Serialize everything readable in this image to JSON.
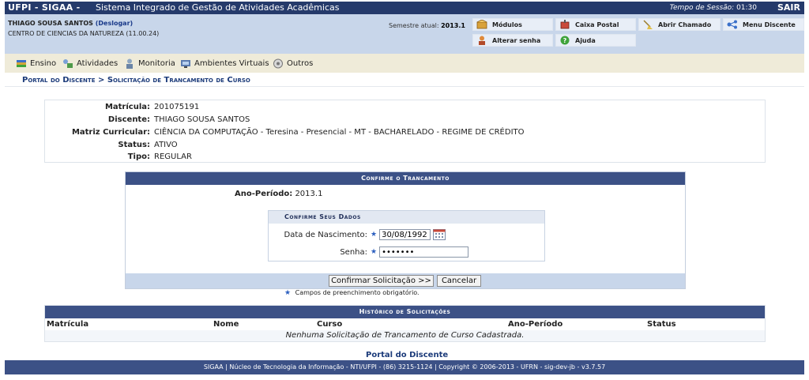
{
  "topbar": {
    "brand": "UFPI - SIGAA -",
    "system": "Sistema Integrado de Gestão de Atividades Acadêmicas",
    "session_label": "Tempo de Sessão:",
    "session_time": "01:30",
    "exit": "SAIR"
  },
  "user": {
    "name": "THIAGO SOUSA SANTOS",
    "logout": "(Deslogar)",
    "center": "CENTRO DE CIENCIAS DA NATUREZA (11.00.24)",
    "semester_label": "Semestre atual:",
    "semester_value": "2013.1"
  },
  "user_buttons": {
    "modulos": "Módulos",
    "caixa_postal": "Caixa Postal",
    "abrir_chamado": "Abrir Chamado",
    "menu_discente": "Menu Discente",
    "alterar_senha": "Alterar senha",
    "ajuda": "Ajuda"
  },
  "menu": {
    "ensino": "Ensino",
    "atividades": "Atividades",
    "monitoria": "Monitoria",
    "ambientes": "Ambientes Virtuais",
    "outros": "Outros"
  },
  "breadcrumb": {
    "root": "Portal do Discente",
    "separator": " > ",
    "current": "Solicitação de Trancamento de Curso"
  },
  "student": {
    "matricula_label": "Matrícula:",
    "matricula": "201075191",
    "discente_label": "Discente:",
    "discente": "THIAGO SOUSA SANTOS",
    "matriz_label": "Matriz Curricular:",
    "matriz": "CIÊNCIA DA COMPUTAÇÃO - Teresina - Presencial - MT - BACHARELADO - REGIME DE CRÉDITO",
    "status_label": "Status:",
    "status": "ATIVO",
    "tipo_label": "Tipo:",
    "tipo": "REGULAR"
  },
  "confirm": {
    "caption": "Confirme o Trancamento",
    "period_label": "Ano-Período:",
    "period_value": "2013.1",
    "data_caption": "Confirme Seus Dados",
    "birth_label": "Data de Nascimento:",
    "birth_value": "30/08/1992",
    "password_label": "Senha:",
    "password_value": "•••••••",
    "confirm_button": "Confirmar Solicitação >>",
    "cancel_button": "Cancelar",
    "required_note": "Campos de preenchimento obrigatório."
  },
  "history": {
    "caption": "Histórico de Solicitações",
    "columns": [
      "Matrícula",
      "Nome",
      "Curso",
      "Ano-Período",
      "Status"
    ],
    "empty": "Nenhuma Solicitação de Trancamento de Curso Cadastrada."
  },
  "portal_link": "Portal do Discente",
  "footer": "SIGAA | Núcleo de Tecnologia da Informação - NTI/UFPI - (86) 3215-1124 | Copyright © 2006-2013 - UFRN - sig-dev-jb - v3.7.57",
  "colors": {
    "header_dark": "#253a6b",
    "user_bar": "#c8d6ea",
    "menu_bar": "#efebd9",
    "panel_caption": "#3c5186",
    "link": "#1c3b7a"
  }
}
